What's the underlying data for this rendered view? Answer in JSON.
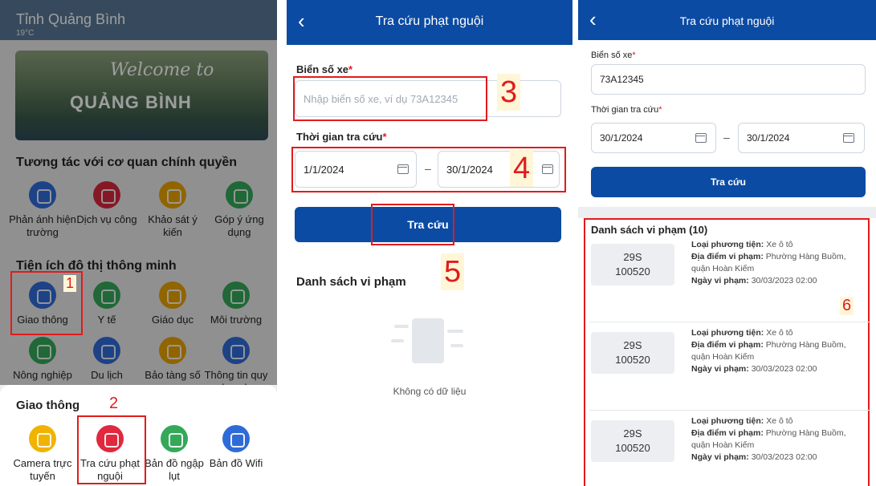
{
  "panel1": {
    "province": "Tỉnh Quảng Bình",
    "temperature": "19°C",
    "banner_welcome": "Welcome to",
    "banner_name": "QUẢNG BÌNH",
    "section_gov": "Tương tác với cơ quan chính quyền",
    "gov_items": [
      "Phản ánh hiện trường",
      "Dịch vụ công",
      "Khảo sát ý kiến",
      "Góp ý ứng dụng"
    ],
    "section_smart": "Tiện ích đô thị thông minh",
    "smart_items": [
      "Giao thông",
      "Y tế",
      "Giáo dục",
      "Môi trường",
      "Nông nghiệp",
      "Du lịch",
      "Bảo tàng số",
      "Thông tin quy hoạch"
    ],
    "sheet_title": "Giao thông",
    "sheet_items": [
      "Camera trực tuyến",
      "Tra cứu phạt nguội",
      "Bản đồ ngập lụt",
      "Bản đồ Wifi"
    ],
    "step1": "1",
    "step2": "2"
  },
  "panel2": {
    "title": "Tra cứu phạt nguội",
    "plate_label": "Biển số xe",
    "plate_placeholder": "Nhập biển số xe, ví dụ 73A12345",
    "time_label": "Thời gian tra cứu",
    "date_from": "1/1/2024",
    "date_to": "30/1/2024",
    "search_button": "Tra cứu",
    "list_title": "Danh sách vi phạm",
    "empty_text": "Không có dữ liệu",
    "step3": "3",
    "step4": "4",
    "step5": "5"
  },
  "panel3": {
    "title": "Tra cứu phạt nguội",
    "plate_label": "Biển số xe",
    "plate_value": "73A12345",
    "time_label": "Thời gian tra cứu",
    "date_from": "30/1/2024",
    "date_to": "30/1/2024",
    "search_button": "Tra cứu",
    "list_title": "Danh sách vi phạm (10)",
    "step6": "6",
    "violations": [
      {
        "plate_line1": "29S",
        "plate_line2": "100520",
        "vehicle_label": "Loại phương tiện:",
        "vehicle": "Xe ô tô",
        "place_label": "Địa điểm vi phạm:",
        "place": "Phường Hàng Buồm, quận Hoàn Kiếm",
        "date_label": "Ngày vi phạm:",
        "date": "30/03/2023 02:00"
      },
      {
        "plate_line1": "29S",
        "plate_line2": "100520",
        "vehicle_label": "Loại phương tiện:",
        "vehicle": "Xe ô tô",
        "place_label": "Địa điểm vi phạm:",
        "place": "Phường Hàng Buồm, quận Hoàn Kiếm",
        "date_label": "Ngày vi phạm:",
        "date": "30/03/2023 02:00"
      },
      {
        "plate_line1": "29S",
        "plate_line2": "100520",
        "vehicle_label": "Loại phương tiện:",
        "vehicle": "Xe ô tô",
        "place_label": "Địa điểm vi phạm:",
        "place": "Phường Hàng Buồm, quận Hoàn Kiếm",
        "date_label": "Ngày vi phạm:",
        "date": "30/03/2023 02:00"
      }
    ]
  },
  "colors": {
    "primary": "#0b4ba3",
    "highlight": "#e21b1b",
    "gov_icons": [
      "#2f6bd8",
      "#d9283e",
      "#e9a400",
      "#35a85a"
    ],
    "smart_icons": [
      "#2f6bd8",
      "#35a85a",
      "#e9a400",
      "#35a85a",
      "#35a85a",
      "#2f6bd8",
      "#e9a400",
      "#2f6bd8"
    ],
    "sheet_icons": [
      "#f0b400",
      "#e0283e",
      "#35a85a",
      "#2f6bd8"
    ]
  },
  "icons": {
    "gov": [
      "megaphone-icon",
      "service-icon",
      "survey-icon",
      "feedback-icon"
    ],
    "smart": [
      "traffic-icon",
      "health-icon",
      "education-icon",
      "environment-icon",
      "agriculture-icon",
      "tourism-icon",
      "museum-icon",
      "planning-icon"
    ],
    "sheet": [
      "camera-icon",
      "fine-lookup-icon",
      "flood-map-icon",
      "wifi-icon"
    ]
  }
}
